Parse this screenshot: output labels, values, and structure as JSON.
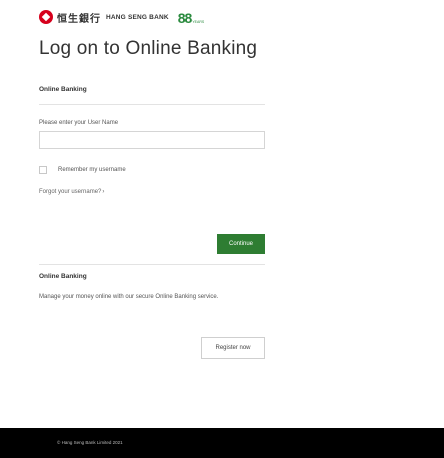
{
  "header": {
    "logo_cn": "恒生銀行",
    "logo_en": "HANG SENG BANK",
    "anniversary_number": "88",
    "anniversary_small": "YEARS"
  },
  "title": "Log on to Online Banking",
  "login": {
    "section_heading": "Online Banking",
    "username_label": "Please enter your User Name",
    "username_value": "",
    "remember_label": "Remember my username",
    "forgot_link": "Forgot your username?",
    "continue_label": "Continue"
  },
  "promo": {
    "heading": "Online Banking",
    "description": "Manage your money online with our secure Online Banking service.",
    "register_label": "Register now"
  },
  "footer": {
    "copyright": "© Hang Seng Bank Limited 2021"
  },
  "colors": {
    "brand_red": "#d6001c",
    "continue_green": "#2e7d32",
    "anniversary_green": "#2a8a3e",
    "footer_bg": "#000000"
  }
}
